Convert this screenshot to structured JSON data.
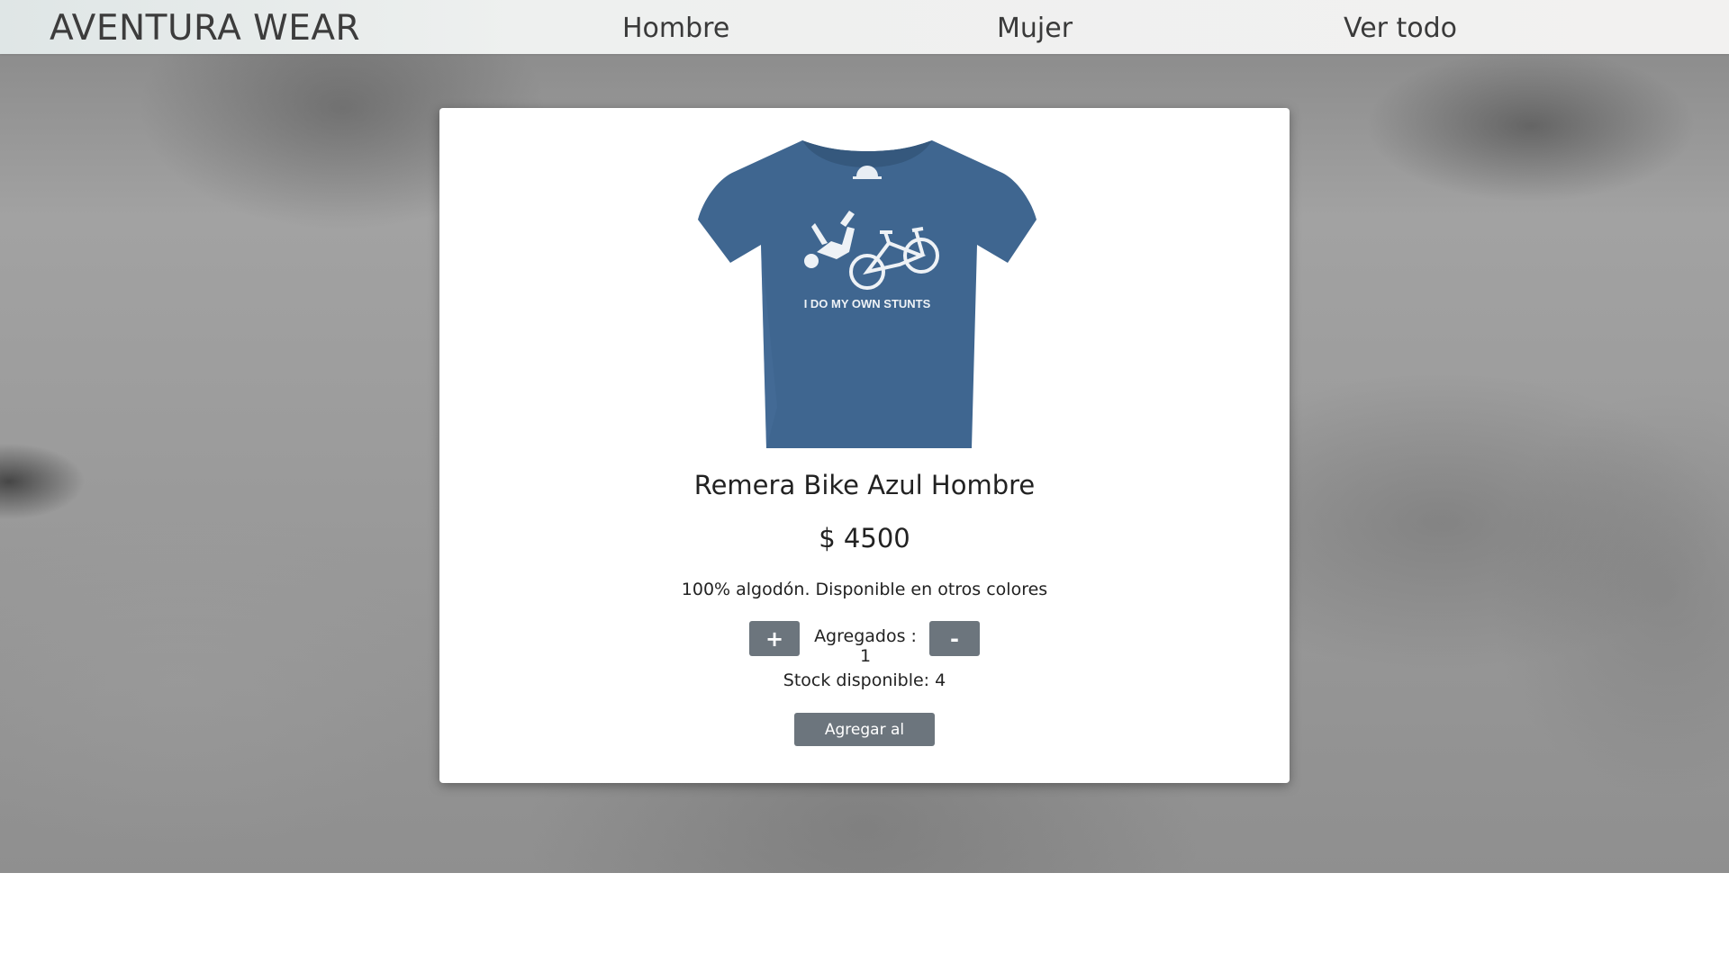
{
  "navbar": {
    "brand": "AVENTURA WEAR",
    "links": [
      "Hombre",
      "Mujer",
      "Ver todo"
    ]
  },
  "product": {
    "image_alt": "Remera azul con estampado de bicicleta",
    "image_print_text": "I DO MY OWN STUNTS",
    "name": "Remera Bike Azul Hombre",
    "price": "$ 4500",
    "description": "100% algodón. Disponible en otros colores",
    "plus_label": "+",
    "minus_label": "-",
    "added_text": "Agregados : 1",
    "stock_text": "Stock disponible: 4",
    "add_to_cart_label": "Agregar al carrito",
    "shirt_color": "#3f6690"
  },
  "colors": {
    "button": "#6c757d",
    "card": "#ffffff"
  }
}
